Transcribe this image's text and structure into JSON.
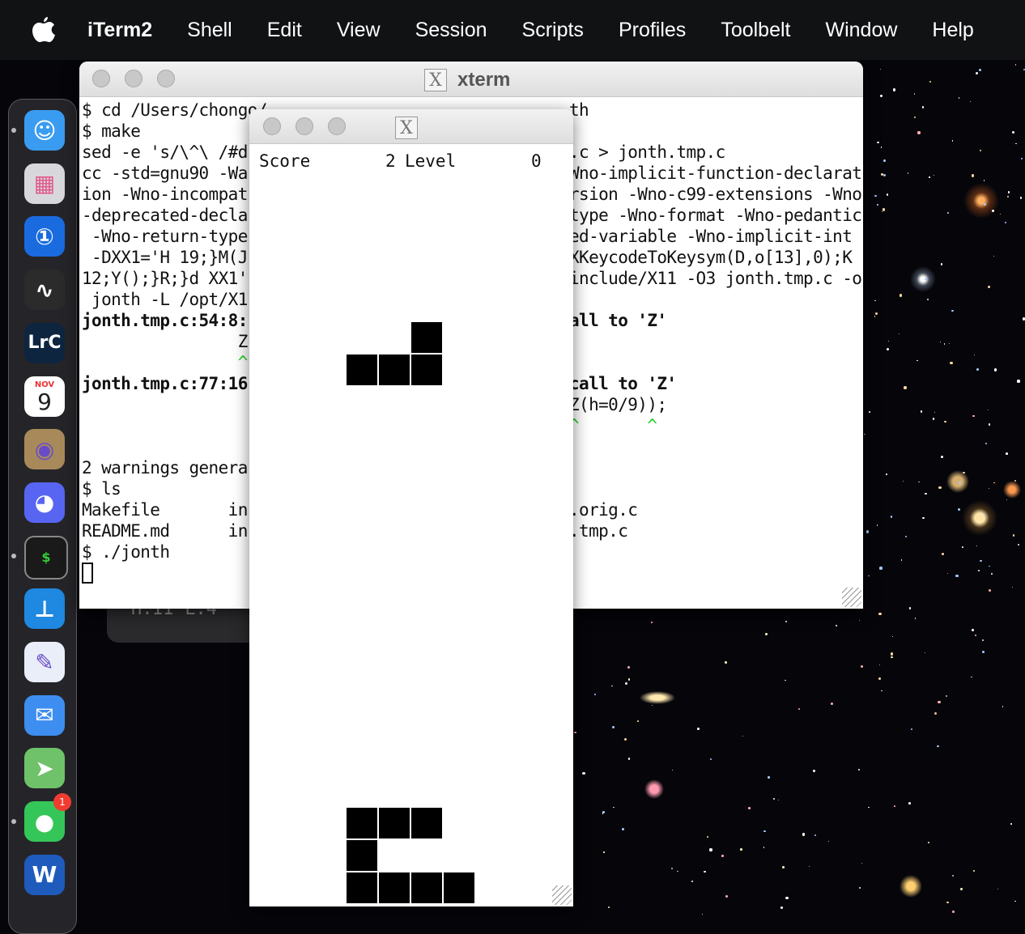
{
  "menubar": {
    "app_name": "iTerm2",
    "items": [
      "Shell",
      "Edit",
      "View",
      "Session",
      "Scripts",
      "Profiles",
      "Toolbelt",
      "Window",
      "Help"
    ]
  },
  "dock": {
    "items": [
      {
        "name": "finder-icon",
        "glyph": "☺",
        "bg": "#3a9cf0",
        "running": true
      },
      {
        "name": "launchpad-icon",
        "glyph": "▦",
        "bg": "#d8d8dc",
        "running": false
      },
      {
        "name": "1password-icon",
        "glyph": "①",
        "bg": "#1a6be0",
        "running": false
      },
      {
        "name": "activity-monitor-icon",
        "glyph": "∿",
        "bg": "#2b2b2b",
        "running": false
      },
      {
        "name": "lightroom-classic-icon",
        "glyph": "LrC",
        "bg": "#0e2540",
        "running": false
      },
      {
        "name": "calendar-icon",
        "glyph": "9",
        "bg": "#ffffff",
        "running": false,
        "month": "NOV"
      },
      {
        "name": "contacts-icon",
        "glyph": "◉",
        "bg": "#a88a5a",
        "running": false
      },
      {
        "name": "discord-icon",
        "glyph": "◕",
        "bg": "#5865f2",
        "running": false
      },
      {
        "name": "terminal-icon",
        "glyph": "$",
        "bg": "#1a1a1a",
        "running": true
      },
      {
        "name": "keynote-icon",
        "glyph": "⊥",
        "bg": "#1f88e0",
        "running": false
      },
      {
        "name": "preview-pencil-icon",
        "glyph": "✎",
        "bg": "#e9eef8",
        "running": false
      },
      {
        "name": "mail-icon",
        "glyph": "✉",
        "bg": "#3d8ef0",
        "running": false
      },
      {
        "name": "maps-icon",
        "glyph": "➤",
        "bg": "#6fc16a",
        "running": false
      },
      {
        "name": "messages-icon",
        "glyph": "●",
        "bg": "#35c659",
        "running": true,
        "badge": "1"
      },
      {
        "name": "word-icon",
        "glyph": "W",
        "bg": "#1e5bbd",
        "running": false
      }
    ]
  },
  "iterm_bg": {
    "text": "H:II  L:4"
  },
  "xterm": {
    "title": "xterm",
    "lines": [
      {
        "text": "$ cd /Users/chongo/",
        "tail": "th",
        "tail_col": 40
      },
      {
        "text": "$ make"
      },
      {
        "text": "sed -e 's/\\^\\ /#d",
        "tail": ".c > jonth.tmp.c",
        "tail_col": 40
      },
      {
        "text": "cc -std=gnu90 -Wa",
        "tail": "Wno-implicit-function-declarat",
        "tail_col": 40
      },
      {
        "text": "ion -Wno-incompat",
        "tail": "rsion -Wno-c99-extensions -Wno",
        "tail_col": 40
      },
      {
        "text": "-deprecated-declar",
        "tail": "type -Wno-format -Wno-pedantic",
        "tail_col": 40
      },
      {
        "text": " -Wno-return-type",
        "tail": "ed-variable -Wno-implicit-int",
        "tail_col": 40
      },
      {
        "text": " -DXX1='H 19;}M(J",
        "tail": "XKeycodeToKeysym(D,o[13],0);K",
        "tail_col": 40
      },
      {
        "text": "12;Y();}R;}d XX1'",
        "tail": "include/X11 -O3 jonth.tmp.c -o",
        "tail_col": 40
      },
      {
        "text": " jonth -L /opt/X1",
        "tail": "",
        "tail_col": 40
      },
      {
        "text": "jonth.tmp.c:54:8:",
        "tail": "all to 'Z'",
        "tail_col": 40,
        "bold": true
      },
      {
        "text": "                Z",
        "tail": "",
        "tail_col": 40
      },
      {
        "text": "                ^",
        "tail": "",
        "tail_col": 40,
        "green": true
      },
      {
        "text": "jonth.tmp.c:77:16",
        "tail": "call to 'Z'",
        "tail_col": 40,
        "bold": true
      },
      {
        "text": "",
        "tail": "Z(h=0/9));",
        "tail_col": 40
      },
      {
        "text": "",
        "tail": "^       ^",
        "tail_col": 40,
        "green": true
      },
      {
        "text": ""
      },
      {
        "text": "2 warnings genera"
      },
      {
        "text": "$ ls"
      },
      {
        "text": "Makefile       in",
        "tail": ".orig.c",
        "tail_col": 40
      },
      {
        "text": "README.md      in",
        "tail": ".tmp.c",
        "tail_col": 40
      },
      {
        "text": "$ ./jonth"
      }
    ]
  },
  "tetris": {
    "score_label": "Score",
    "score_value": "2",
    "level_label": "Level",
    "level_value": "0",
    "falling_piece": [
      [
        5,
        0
      ],
      [
        3,
        1
      ],
      [
        4,
        1
      ],
      [
        5,
        1
      ]
    ],
    "stack": [
      [
        3,
        0
      ],
      [
        4,
        0
      ],
      [
        5,
        0
      ],
      [
        3,
        1
      ],
      [
        3,
        2
      ],
      [
        4,
        2
      ],
      [
        5,
        2
      ],
      [
        6,
        2
      ]
    ]
  }
}
